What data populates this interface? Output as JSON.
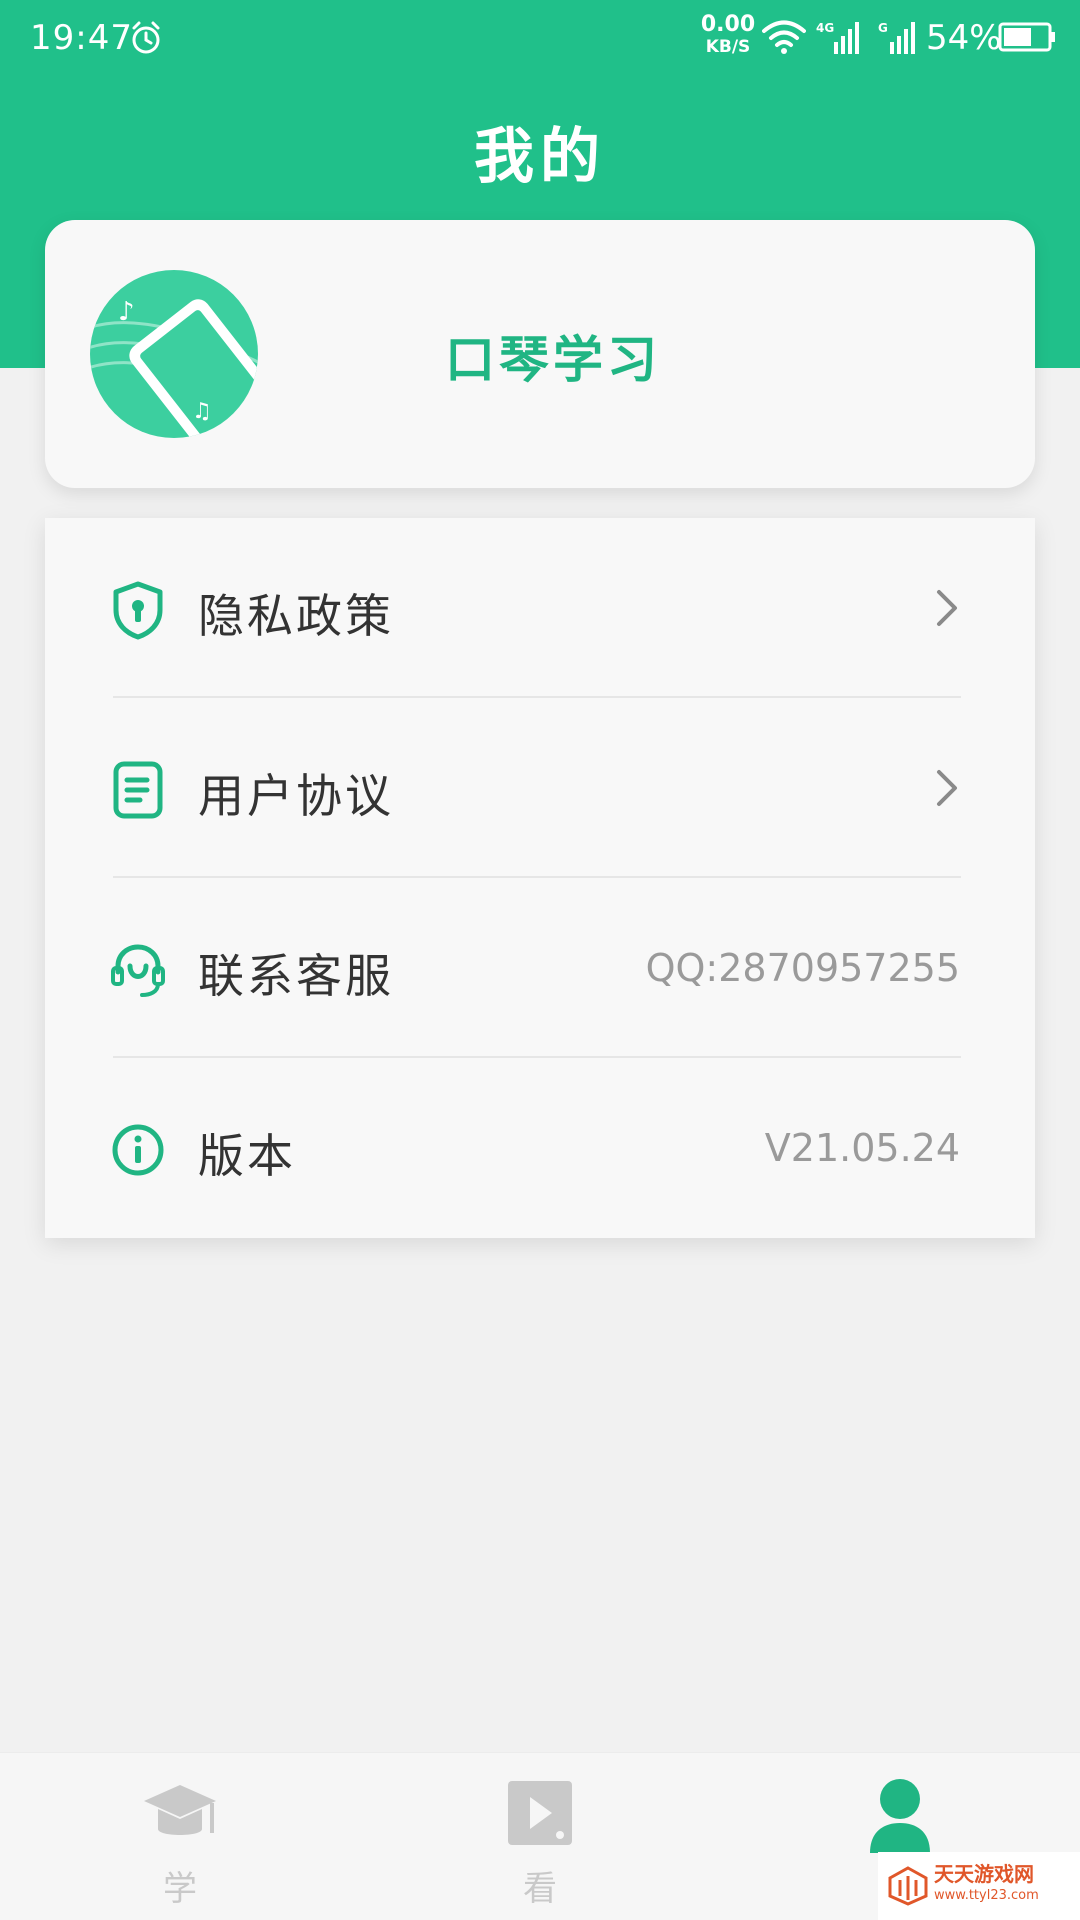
{
  "status_bar": {
    "time": "19:47",
    "net_speed_value": "0.00",
    "net_speed_unit": "KB/S",
    "signal1_label": "4G",
    "signal2_label": "G",
    "battery": "54%"
  },
  "header": {
    "title": "我的"
  },
  "profile": {
    "app_name": "口琴学习"
  },
  "menu": {
    "items": [
      {
        "label": "隐私政策",
        "icon": "shield-keyhole-icon",
        "has_chevron": true
      },
      {
        "label": "用户协议",
        "icon": "document-icon",
        "has_chevron": true
      },
      {
        "label": "联系客服",
        "icon": "headset-icon",
        "value": "QQ:2870957255"
      },
      {
        "label": "版本",
        "icon": "info-icon",
        "value": "V21.05.24"
      }
    ]
  },
  "tab_bar": {
    "tabs": [
      {
        "label": "学",
        "icon": "graduation-cap-icon",
        "active": false
      },
      {
        "label": "看",
        "icon": "video-play-icon",
        "active": false
      },
      {
        "label": "",
        "icon": "user-icon",
        "active": true
      }
    ]
  },
  "watermark": {
    "name": "天天游戏网",
    "url": "www.ttyl23.com"
  },
  "colors": {
    "accent": "#20c08a",
    "background": "#f1f1f1",
    "card": "#f8f8f8",
    "text": "#333333",
    "muted": "#9a9a9a"
  }
}
